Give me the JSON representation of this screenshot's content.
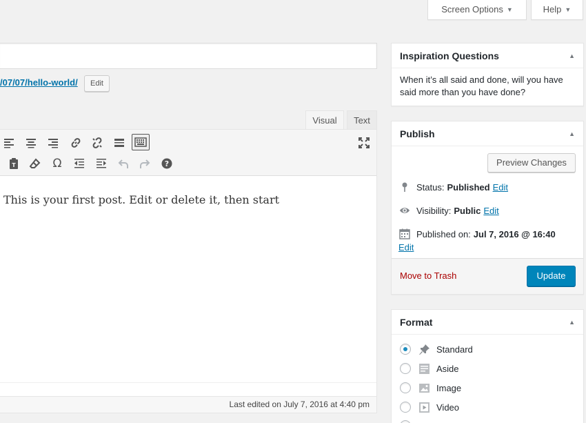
{
  "top_buttons": {
    "screen_options": "Screen Options",
    "help": "Help"
  },
  "permalink": {
    "url_text": "/07/07/hello-world/",
    "edit_label": "Edit"
  },
  "editor": {
    "tabs": {
      "visual": "Visual",
      "text": "Text"
    },
    "content": "This is your first post. Edit or delete it, then start",
    "last_edited": "Last edited on July 7, 2016 at 4:40 pm"
  },
  "inspiration": {
    "title": "Inspiration Questions",
    "body": "When it’s all said and done, will you have said more than you have done?"
  },
  "publish": {
    "title": "Publish",
    "preview_label": "Preview Changes",
    "status_label": "Status:",
    "status_value": "Published",
    "visibility_label": "Visibility:",
    "visibility_value": "Public",
    "published_label": "Published on:",
    "published_value": "Jul 7, 2016 @ 16:40",
    "edit_label": "Edit",
    "trash_label": "Move to Trash",
    "update_label": "Update"
  },
  "format": {
    "title": "Format",
    "options": [
      "Standard",
      "Aside",
      "Image",
      "Video"
    ],
    "selected": "Standard"
  },
  "colors": {
    "primary": "#0085ba",
    "link": "#0073aa",
    "trash": "#a00"
  }
}
